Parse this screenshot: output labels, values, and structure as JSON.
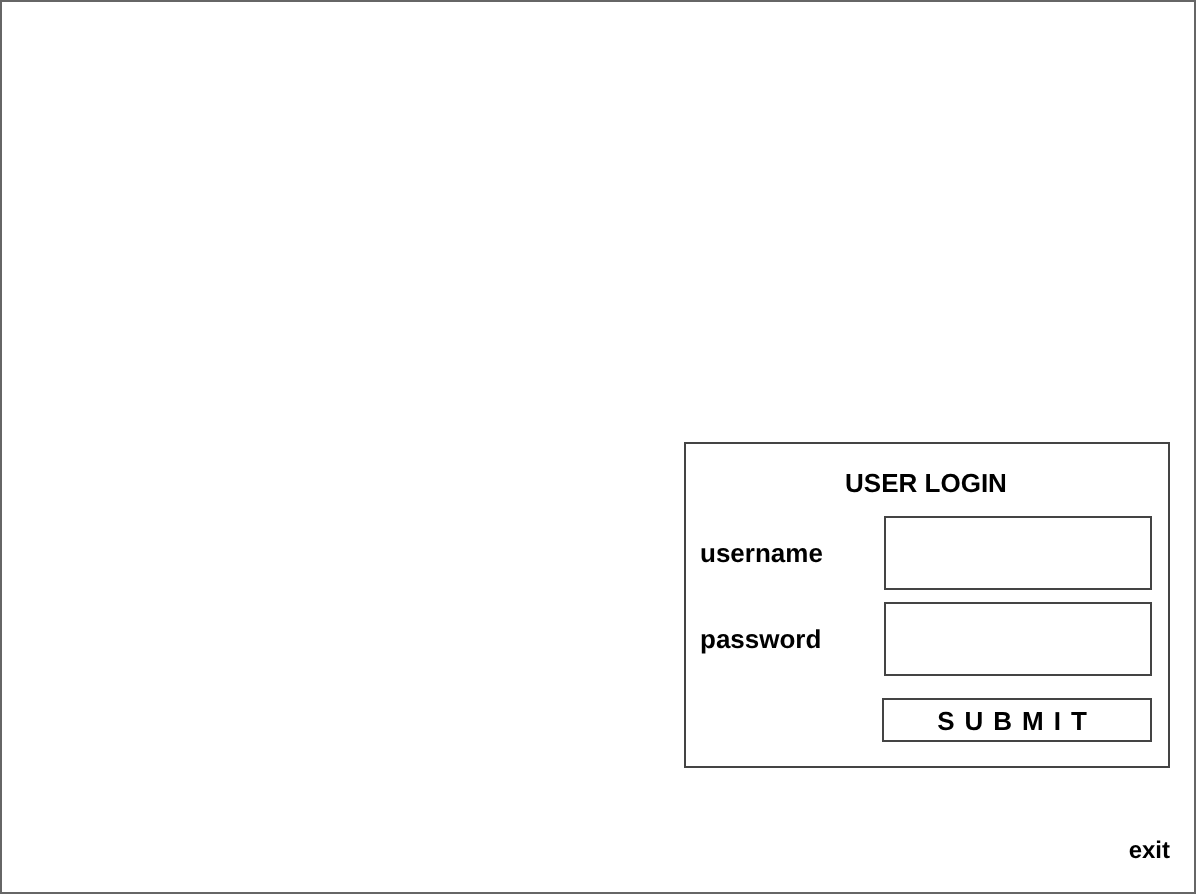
{
  "login": {
    "title": "USER LOGIN",
    "fields": [
      {
        "label": "username"
      },
      {
        "label": "password"
      }
    ],
    "submit": "SUBMIT"
  },
  "exit": "exit"
}
